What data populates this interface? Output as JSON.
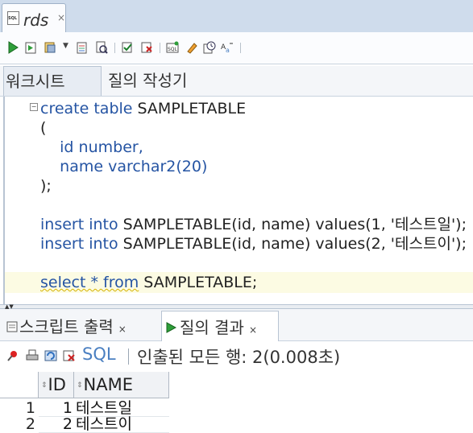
{
  "document_tab": {
    "title": "rds",
    "close": "×"
  },
  "toolbar": {
    "icons": [
      "run-statement-icon",
      "run-script-icon",
      "autotrace-icon",
      "dropdown-icon",
      "explain-plan-icon",
      "sql-tuning-icon",
      "commit-icon",
      "rollback-icon",
      "unshared-sql-icon",
      "clear-icon",
      "history-icon",
      "format-icon"
    ]
  },
  "editor_tabs": [
    "워크시트",
    "질의 작성기"
  ],
  "editor": {
    "lines": [
      [
        "create table",
        " SAMPLETABLE"
      ],
      [
        "("
      ],
      [
        "    id number,"
      ],
      [
        "    name varchar2(20)"
      ],
      [
        ");"
      ],
      [
        ""
      ],
      [
        "insert into",
        " SAMPLETABLE(id, name) values(1, '테스트일');"
      ],
      [
        "insert into",
        " SAMPLETABLE(id, name) values(2, '테스트이');"
      ],
      [
        ""
      ],
      [
        "select * from",
        " SAMPLETABLE;"
      ]
    ]
  },
  "bottom_tabs": {
    "script_output": "스크립트 출력",
    "query_result": "질의 결과",
    "close": "×"
  },
  "result_toolbar": {
    "sql_label": "SQL",
    "status": "인출된 모든 행: 2(0.008초)"
  },
  "grid": {
    "columns": [
      "ID",
      "NAME"
    ],
    "rows": [
      {
        "rownum": "1",
        "id": "1",
        "name": "테스트일"
      },
      {
        "rownum": "2",
        "id": "2",
        "name": "테스트이"
      }
    ]
  },
  "colors": {
    "keyword": "#2554a3",
    "tab_strip": "#cfdcec",
    "link": "#4a7fc1"
  }
}
